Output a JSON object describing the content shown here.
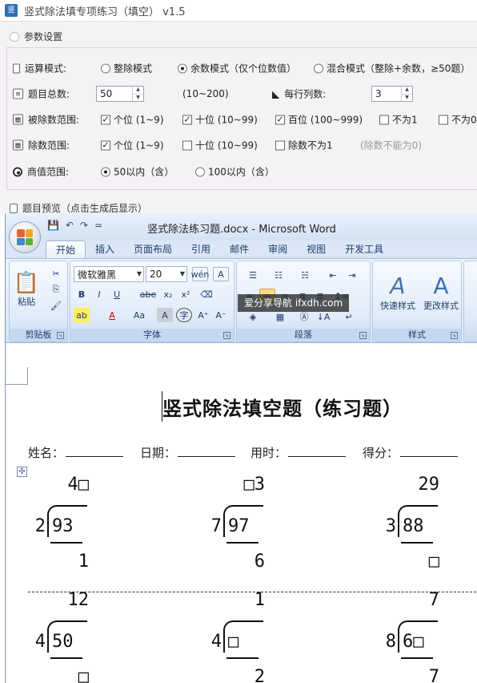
{
  "app": {
    "title": "竖式除法填专项练习（填空） v1.5",
    "icon_text": "竖"
  },
  "params": {
    "group_title": "参数设置",
    "op_mode": {
      "label": "运算模式:",
      "options": [
        "整除模式",
        "余数模式（仅个位数值）",
        "混合模式（整除+余数，≥50题）"
      ],
      "selected": 1
    },
    "count": {
      "label": "题目总数:",
      "value": "50",
      "hint": "(10~200)"
    },
    "per_row": {
      "label": "每行列数:",
      "value": "3"
    },
    "dividend_range": {
      "label": "被除数范围:",
      "options": [
        "个位 (1~9)",
        "十位 (10~99)",
        "百位 (100~999)",
        "不为1",
        "不为0"
      ],
      "checked": [
        true,
        true,
        true,
        false,
        false
      ]
    },
    "divisor_range": {
      "label": "除数范围:",
      "options": [
        "个位 (1~9)",
        "十位 (10~99)",
        "除数不为1"
      ],
      "checked": [
        true,
        false,
        false
      ],
      "note": "(除数不能为0)"
    },
    "quotient_range": {
      "label": "商值范围:",
      "options": [
        "50以内（含）",
        "100以内（含）"
      ],
      "selected": 0
    },
    "preview_label": "题目预览（点击生成后显示）"
  },
  "word": {
    "title": "竖式除法练习题.docx - Microsoft Word",
    "qat": [
      "💾",
      "↶",
      "↷",
      "="
    ],
    "tabs": [
      "开始",
      "插入",
      "页面布局",
      "引用",
      "邮件",
      "审阅",
      "视图",
      "开发工具"
    ],
    "active_tab": 0,
    "groups": {
      "clipboard": {
        "label": "剪贴板",
        "paste": "粘贴"
      },
      "font": {
        "label": "字体",
        "font_name": "微软雅黑",
        "font_size": "20",
        "buttons": [
          "B",
          "I",
          "U",
          "abe",
          "x₂",
          "x²",
          "Aa",
          "A",
          "字",
          "A⁺",
          "A⁻"
        ]
      },
      "paragraph": {
        "label": "段落"
      },
      "styles": {
        "label": "样式",
        "quick": "快速样式",
        "change": "更改样式"
      }
    },
    "watermark": "爱分享导航 ifxdh.com"
  },
  "doc": {
    "title": "竖式除法填空题（练习题）",
    "fields": [
      "姓名：",
      "日期：",
      "用时：",
      "得分："
    ],
    "problems": [
      {
        "quotient": "4□",
        "divisor": "2",
        "dividend": "93",
        "remainder": "1"
      },
      {
        "quotient": "□3",
        "divisor": "7",
        "dividend": "97",
        "remainder": "6"
      },
      {
        "quotient": "29",
        "divisor": "3",
        "dividend": "88",
        "remainder": "□"
      },
      {
        "quotient": "12",
        "divisor": "4",
        "dividend": "50",
        "remainder": "□"
      },
      {
        "quotient": "1",
        "divisor": "4",
        "dividend": "□",
        "remainder": "2"
      },
      {
        "quotient": "7",
        "divisor": "8",
        "dividend": "6□",
        "remainder": "7"
      }
    ]
  }
}
